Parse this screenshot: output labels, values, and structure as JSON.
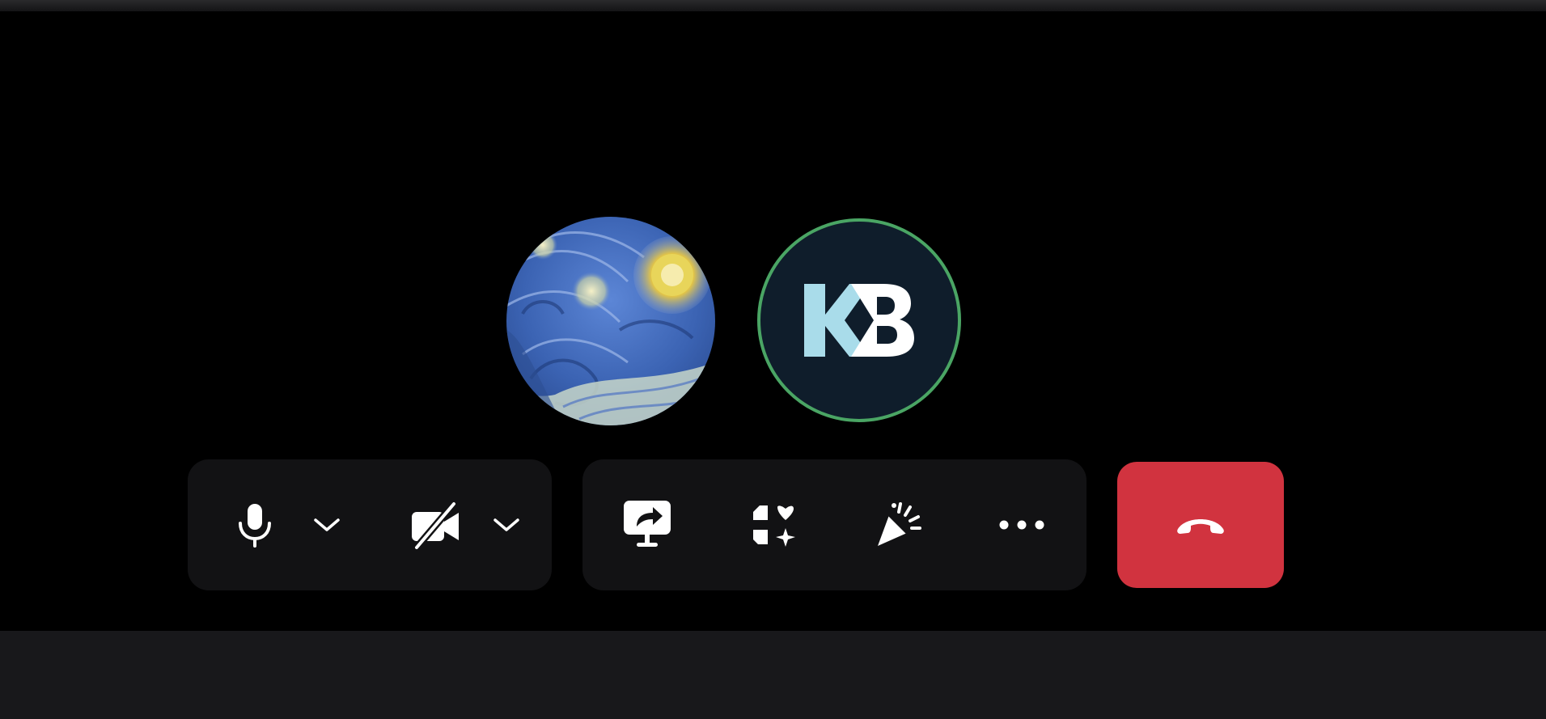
{
  "participants": [
    {
      "avatar": "starry-night-painting"
    },
    {
      "avatar_initials": "KB",
      "speaking_ring_color": "#4aa564",
      "background": "#0f1d2b"
    }
  ],
  "controls": {
    "audio_group": [
      {
        "icon": "microphone-icon"
      },
      {
        "icon": "chevron-down-icon"
      },
      {
        "icon": "camera-off-icon"
      },
      {
        "icon": "chevron-down-icon"
      }
    ],
    "action_group": [
      {
        "icon": "share-screen-icon"
      },
      {
        "icon": "apps-icon"
      },
      {
        "icon": "reactions-icon"
      },
      {
        "icon": "more-icon"
      }
    ],
    "leave": {
      "icon": "hang-up-icon",
      "color": "#d1333f"
    }
  },
  "colors": {
    "background": "#000000",
    "control_bar": "#121214",
    "icon": "#ffffff"
  }
}
